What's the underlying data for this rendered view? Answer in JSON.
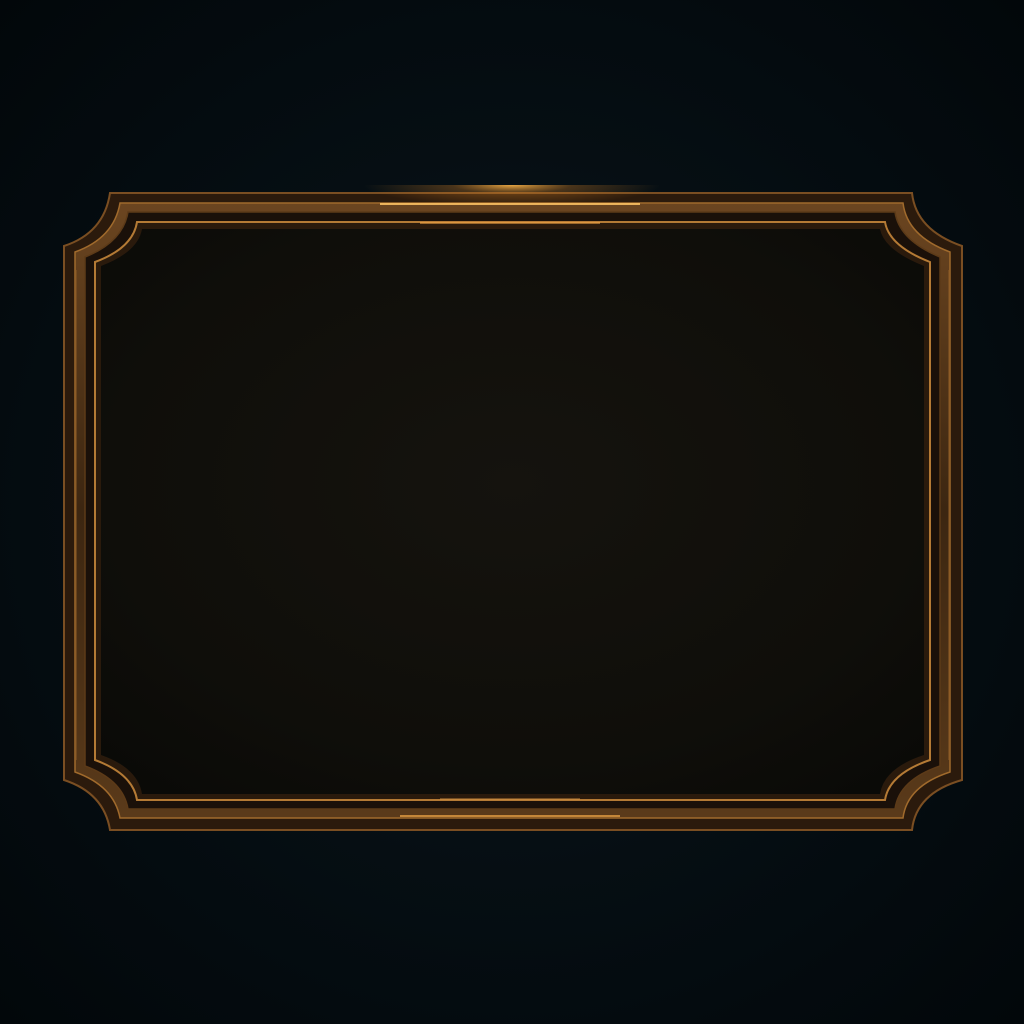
{
  "scene": {
    "description_free": true,
    "colors": {
      "background": "#03090d",
      "frame_gold": "#c98a3a",
      "frame_dark_bronze": "#3a2310",
      "frame_highlight": "#ffb34d",
      "panel_fill": "#100f0b"
    },
    "panel": {
      "text": ""
    }
  }
}
